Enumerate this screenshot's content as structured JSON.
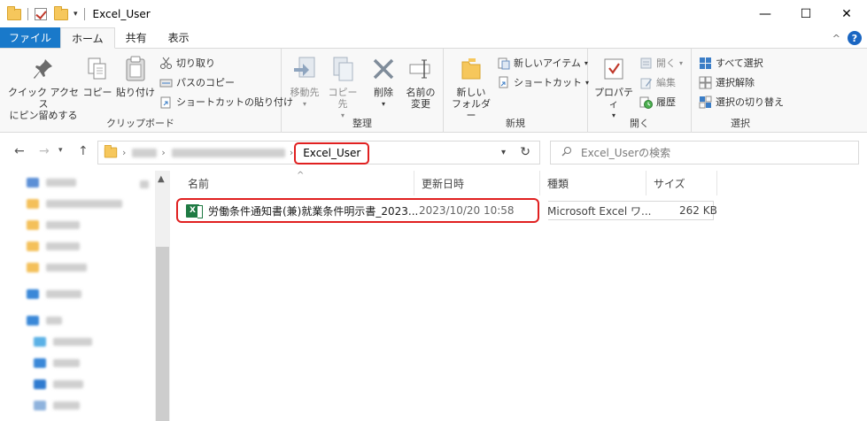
{
  "window": {
    "title": "Excel_User",
    "minimize": "—",
    "maximize": "☐",
    "close": "✕"
  },
  "tabs": {
    "file": "ファイル",
    "home": "ホーム",
    "share": "共有",
    "view": "表示",
    "collapse": "^",
    "help": "?"
  },
  "ribbon": {
    "clipboard": {
      "label": "クリップボード",
      "pin_line1": "クイック アクセス",
      "pin_line2": "にピン留めする",
      "copy": "コピー",
      "paste": "貼り付け",
      "cut": "切り取り",
      "copy_path": "パスのコピー",
      "paste_shortcut": "ショートカットの貼り付け"
    },
    "organize": {
      "label": "整理",
      "move_to": "移動先",
      "copy_to": "コピー先",
      "delete": "削除",
      "rename_line1": "名前の",
      "rename_line2": "変更"
    },
    "new": {
      "label": "新規",
      "new_folder_line1": "新しい",
      "new_folder_line2": "フォルダー",
      "new_item": "新しいアイテム",
      "shortcut": "ショートカット"
    },
    "open": {
      "label": "開く",
      "properties": "プロパティ",
      "open": "開く",
      "edit": "編集",
      "history": "履歴"
    },
    "select": {
      "label": "選択",
      "select_all": "すべて選択",
      "select_none": "選択解除",
      "invert": "選択の切り替え"
    }
  },
  "address": {
    "current": "Excel_User",
    "search_placeholder": "Excel_Userの検索"
  },
  "columns": {
    "name": "名前",
    "date": "更新日時",
    "type": "種類",
    "size": "サイズ"
  },
  "files": [
    {
      "name": "労働条件通知書(兼)就業条件明示書_2023...",
      "date": "2023/10/20 10:58",
      "type": "Microsoft Excel ワ...",
      "size": "262 KB"
    }
  ],
  "colors": {
    "accent": "#1979ca",
    "highlight": "#e02020",
    "excel": "#1e7a43",
    "folder": "#f6c75c"
  }
}
